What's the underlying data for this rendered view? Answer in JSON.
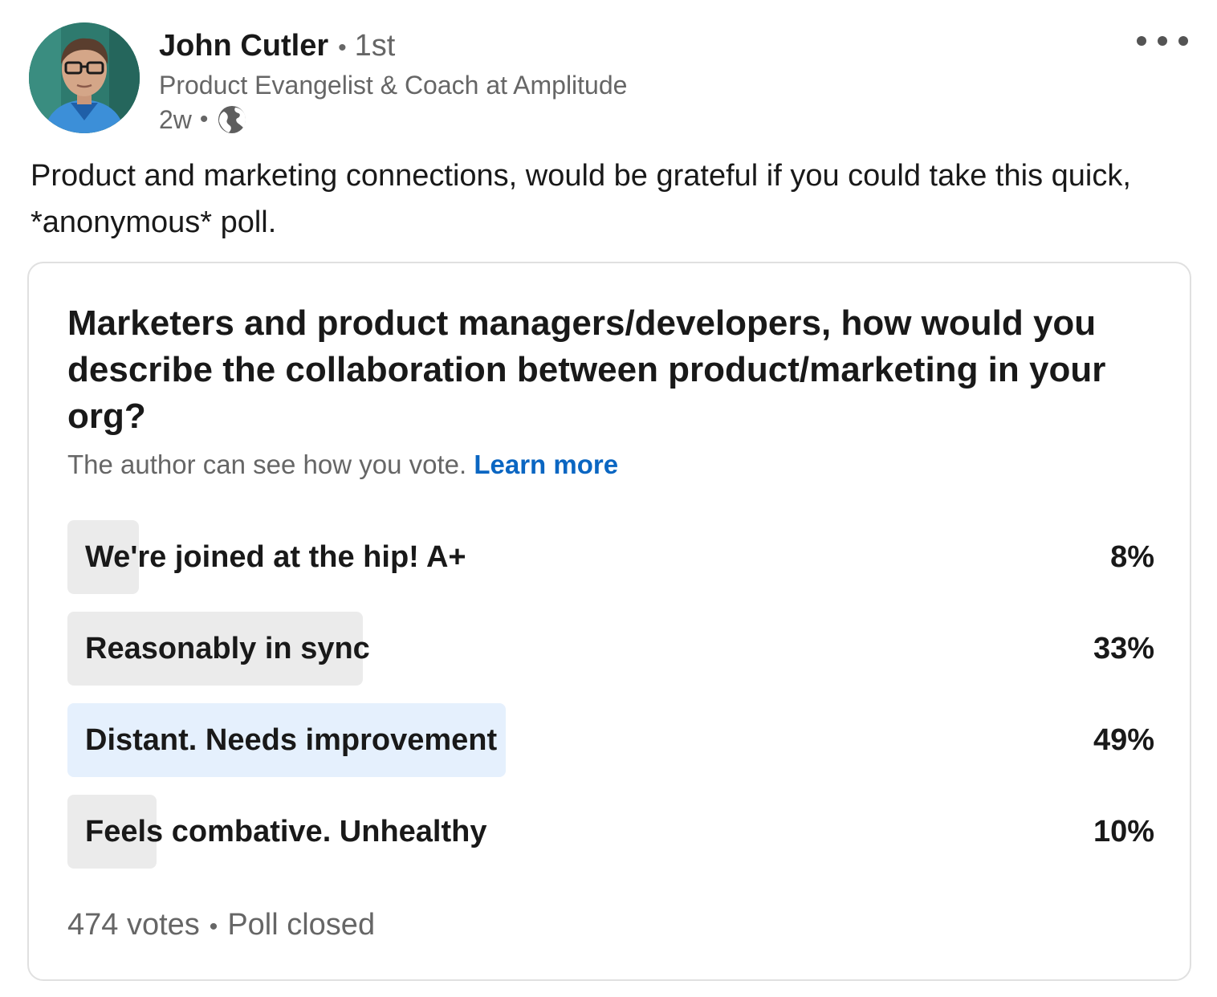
{
  "post": {
    "author": {
      "name": "John Cutler",
      "degree": "1st",
      "headline": "Product Evangelist & Coach at Amplitude",
      "time": "2w",
      "visibility_icon": "globe-icon"
    },
    "separator": "•",
    "more_icon": "more-horizontal-icon",
    "text": "Product and marketing connections, would be grateful if you could take this quick, *anonymous* poll."
  },
  "poll": {
    "question": "Marketers and product managers/developers, how would you describe the collaboration between product/marketing in your org?",
    "visibility_note": "The author can see how you vote.",
    "learn_more": "Learn more",
    "options": [
      {
        "label": "We're joined at the hip! A+",
        "percent_label": "8%",
        "percent": 8,
        "selected": false
      },
      {
        "label": "Reasonably in sync",
        "percent_label": "33%",
        "percent": 33,
        "selected": false
      },
      {
        "label": "Distant. Needs improvement",
        "percent_label": "49%",
        "percent": 49,
        "selected": true
      },
      {
        "label": "Feels combative. Unhealthy",
        "percent_label": "10%",
        "percent": 10,
        "selected": false
      }
    ],
    "votes": "474 votes",
    "status": "Poll closed"
  },
  "colors": {
    "link": "#0a66c2",
    "bar_default": "#ebebeb",
    "bar_selected": "#e5f0fd",
    "text_primary": "#191919",
    "text_secondary": "#666666"
  }
}
